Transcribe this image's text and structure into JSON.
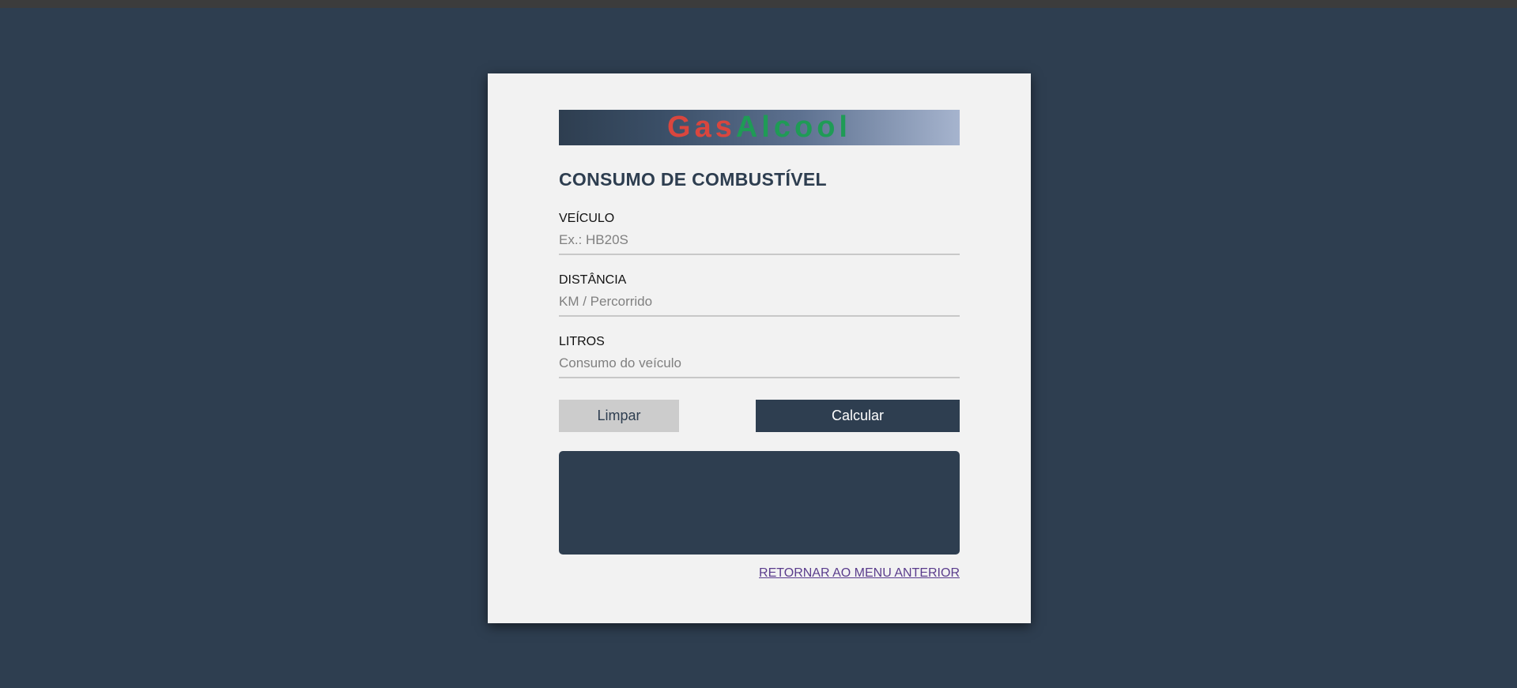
{
  "logo": {
    "part1": "Gas",
    "part2": "Alcool",
    "colors": {
      "gas": "#d9463e",
      "alcool": "#1f9b56"
    }
  },
  "form": {
    "title": "CONSUMO DE COMBUSTÍVEL",
    "fields": [
      {
        "label": "VEÍCULO",
        "placeholder": "Ex.: HB20S",
        "value": ""
      },
      {
        "label": "DISTÂNCIA",
        "placeholder": "KM / Percorrido",
        "value": ""
      },
      {
        "label": "LITROS",
        "placeholder": "Consumo do veículo",
        "value": ""
      }
    ],
    "clear_label": "Limpar",
    "calculate_label": "Calcular",
    "result_text": ""
  },
  "footer": {
    "back_link": "RETORNAR AO MENU ANTERIOR"
  },
  "theme": {
    "background": "#2e3e50",
    "card": "#f2f2f2",
    "accent": "#2e3e50"
  }
}
